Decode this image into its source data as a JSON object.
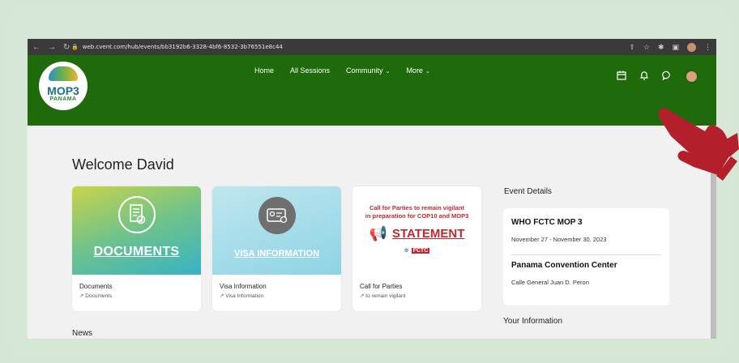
{
  "browser": {
    "url": "web.cvent.com/hub/events/bb3192b6-3328-4bf6-8532-3b76551e8c44"
  },
  "brand": {
    "logo_line1": "MOP3",
    "logo_line2": "PANAMA",
    "nav_color": "#1f6a0b"
  },
  "nav": {
    "items": [
      {
        "label": "Home"
      },
      {
        "label": "All Sessions"
      },
      {
        "label": "Community"
      },
      {
        "label": "More"
      }
    ]
  },
  "main": {
    "welcome": "Welcome David",
    "cards": [
      {
        "name": "Documents",
        "link": "Documents",
        "image_text": "DOCUMENTS"
      },
      {
        "name": "Visa Information",
        "link": "Visa Information",
        "image_text": "VISA INFORMATION"
      },
      {
        "name": "Call for Parties",
        "link": "to remain vigilant",
        "image_line1": "Call for Parties to remain vigilant",
        "image_line2": "in preparation for COP10 and MOP3",
        "image_title": "STATEMENT",
        "image_brand": "FCTC"
      }
    ],
    "news": "News"
  },
  "event": {
    "section_title": "Event Details",
    "name": "WHO FCTC MOP 3",
    "dates": "November 27 - November 30, 2023",
    "venue": "Panama Convention Center",
    "address": "Calle General Juan D. Peron",
    "your_info": "Your Information"
  },
  "icons": {
    "calendar": "calendar-icon",
    "bell": "bell-icon",
    "chat": "chat-icon",
    "avatar": "avatar"
  }
}
